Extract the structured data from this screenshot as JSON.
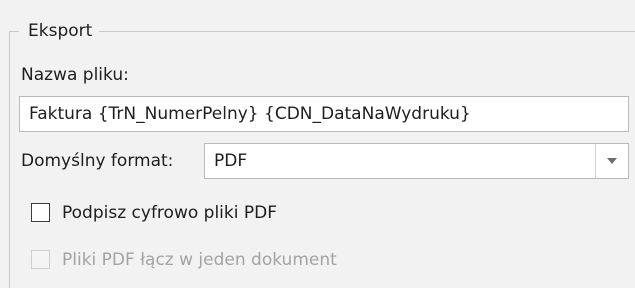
{
  "export_group": {
    "title": "Eksport",
    "file_name_label": "Nazwa pliku:",
    "file_name_value": "Faktura {TrN_NumerPelny} {CDN_DataNaWydruku}",
    "default_format_label": "Domyślny format:",
    "default_format_value": "PDF",
    "sign_pdf_label": "Podpisz cyfrowo pliki PDF",
    "sign_pdf_checked": false,
    "merge_pdf_label": "Pliki PDF łącz w jeden dokument",
    "merge_pdf_checked": false,
    "merge_pdf_enabled": false
  },
  "icons": {
    "dropdown": "chevron-down-icon"
  },
  "colors": {
    "border": "#c8c8c8",
    "disabled_text": "#a3a3a3",
    "background": "#f2f2f2"
  }
}
